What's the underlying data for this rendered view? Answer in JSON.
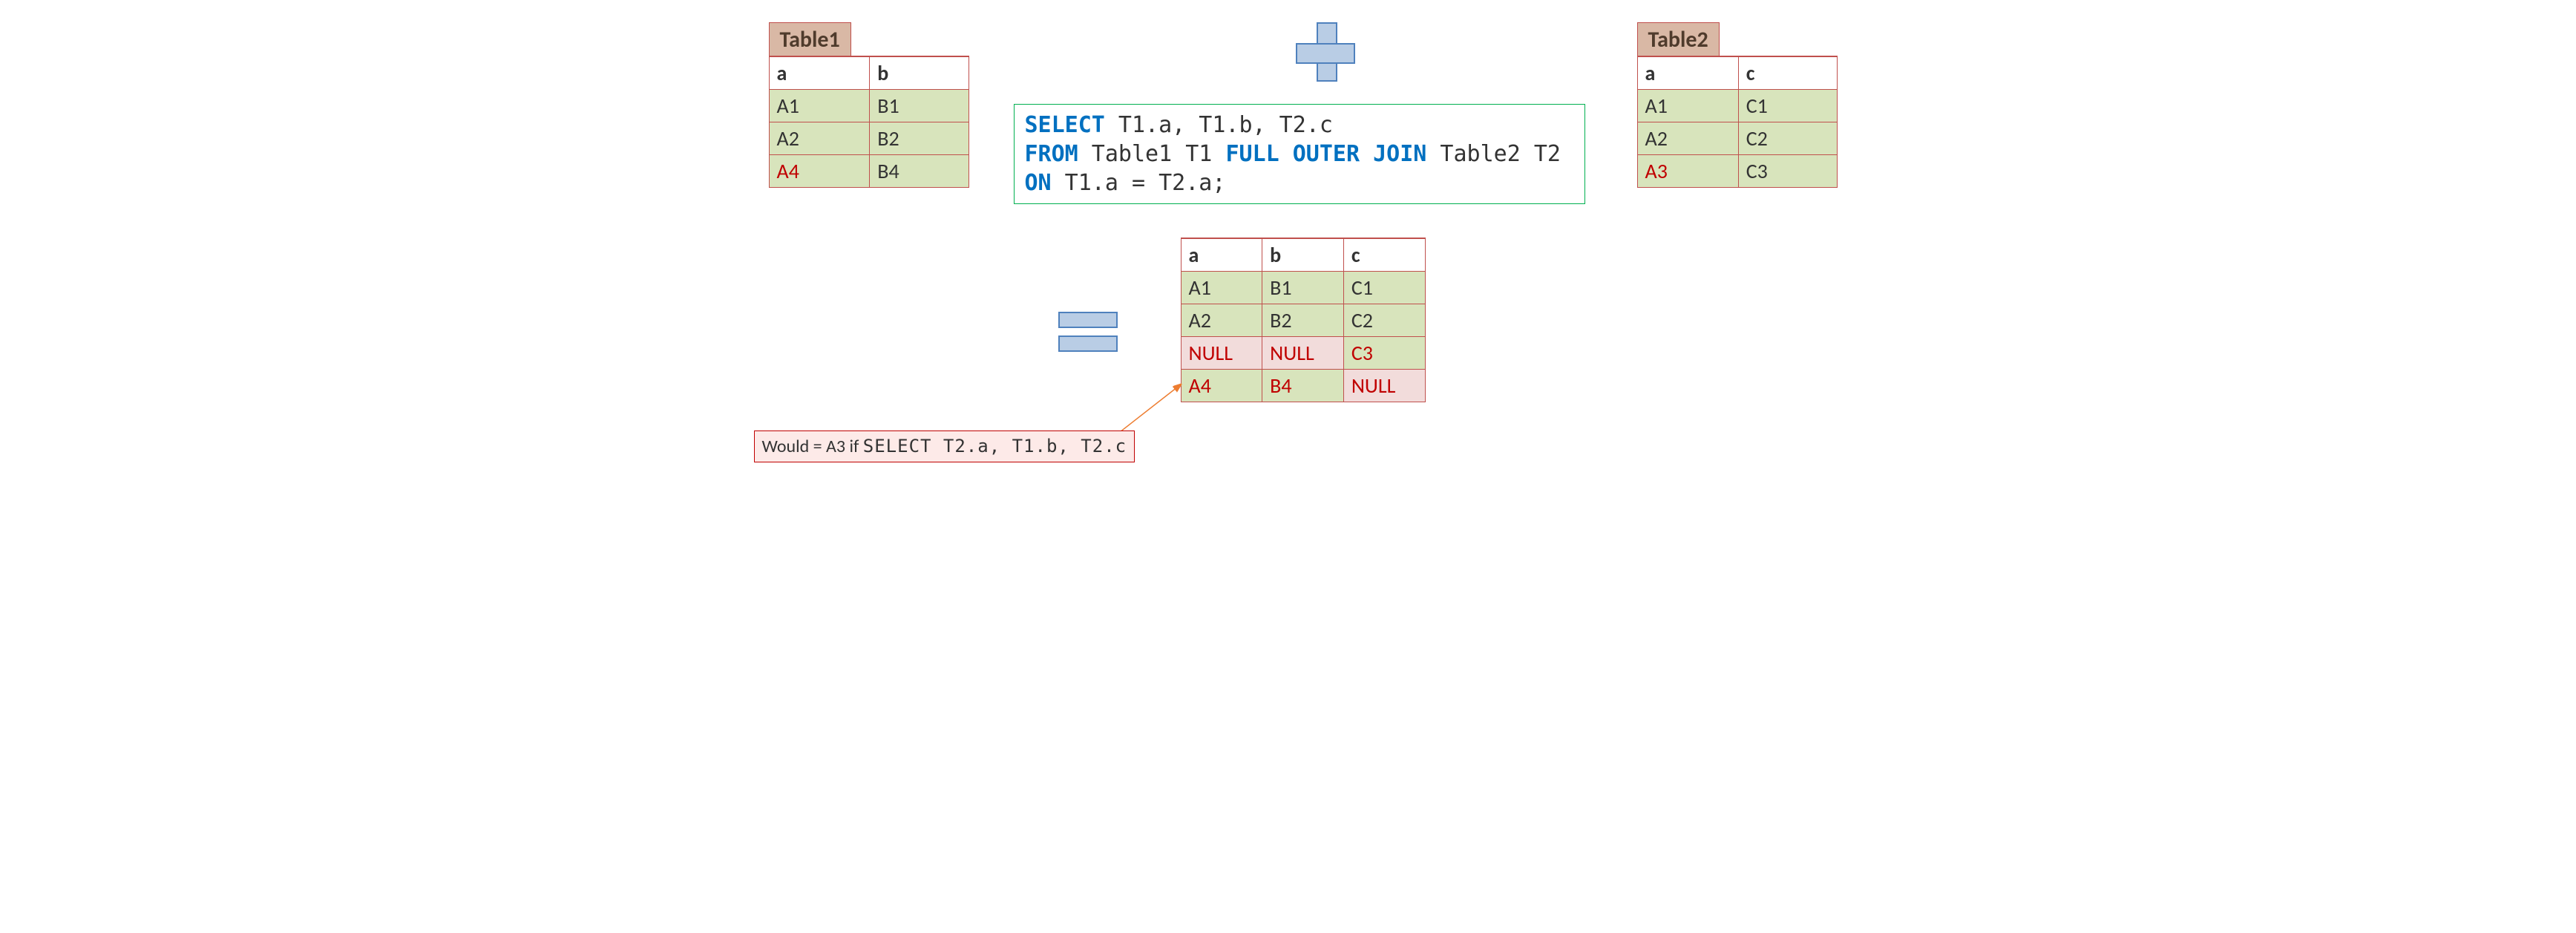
{
  "table1": {
    "title": "Table1",
    "cols": [
      "a",
      "b"
    ],
    "rows": [
      [
        {
          "v": "A1"
        },
        {
          "v": "B1"
        }
      ],
      [
        {
          "v": "A2"
        },
        {
          "v": "B2"
        }
      ],
      [
        {
          "v": "A4",
          "red": true
        },
        {
          "v": "B4"
        }
      ]
    ]
  },
  "table2": {
    "title": "Table2",
    "cols": [
      "a",
      "c"
    ],
    "rows": [
      [
        {
          "v": "A1"
        },
        {
          "v": "C1"
        }
      ],
      [
        {
          "v": "A2"
        },
        {
          "v": "C2"
        }
      ],
      [
        {
          "v": "A3",
          "red": true
        },
        {
          "v": "C3"
        }
      ]
    ]
  },
  "sql": {
    "line1_kw": "SELECT",
    "line1_rest": " T1.a, T1.b, T2.c",
    "line2_kw1": "FROM",
    "line2_mid": " Table1 T1 ",
    "line2_kw2": "FULL OUTER JOIN",
    "line2_rest": " Table2 T2",
    "line3_kw": "ON",
    "line3_rest": " T1.a = T2.a;"
  },
  "result": {
    "cols": [
      "a",
      "b",
      "c"
    ],
    "rows": [
      [
        {
          "v": "A1"
        },
        {
          "v": "B1"
        },
        {
          "v": "C1"
        }
      ],
      [
        {
          "v": "A2"
        },
        {
          "v": "B2"
        },
        {
          "v": "C2"
        }
      ],
      [
        {
          "v": "NULL",
          "null": true
        },
        {
          "v": "NULL",
          "null": true
        },
        {
          "v": "C3",
          "red": true
        }
      ],
      [
        {
          "v": "A4",
          "red": true
        },
        {
          "v": "B4",
          "red": true
        },
        {
          "v": "NULL",
          "null": true
        }
      ]
    ]
  },
  "callout": {
    "prefix": "Would = A3 if ",
    "code": "SELECT  T2.a,  T1.b,  T2.c"
  }
}
